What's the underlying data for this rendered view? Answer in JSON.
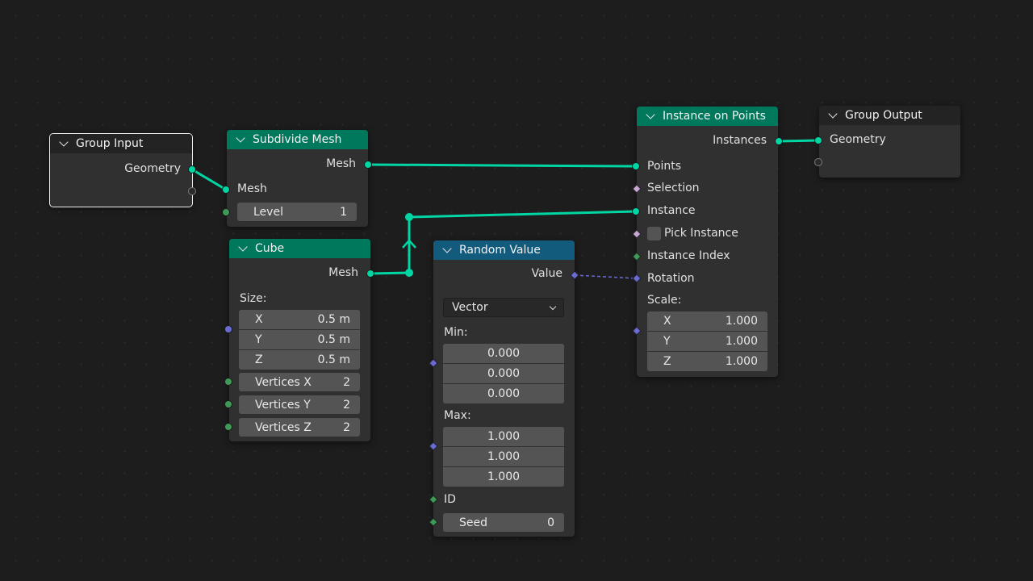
{
  "group_input": {
    "title": "Group Input",
    "geometry": "Geometry"
  },
  "subdivide_mesh": {
    "title": "Subdivide Mesh",
    "mesh_out": "Mesh",
    "mesh_in": "Mesh",
    "level_label": "Level",
    "level_value": "1"
  },
  "cube": {
    "title": "Cube",
    "mesh_out": "Mesh",
    "size_label": "Size:",
    "size": [
      {
        "axis": "X",
        "value": "0.5 m"
      },
      {
        "axis": "Y",
        "value": "0.5 m"
      },
      {
        "axis": "Z",
        "value": "0.5 m"
      }
    ],
    "vertices": [
      {
        "label": "Vertices X",
        "value": "2"
      },
      {
        "label": "Vertices Y",
        "value": "2"
      },
      {
        "label": "Vertices Z",
        "value": "2"
      }
    ]
  },
  "random_value": {
    "title": "Random Value",
    "value_out": "Value",
    "type": "Vector",
    "min_label": "Min:",
    "min": [
      "0.000",
      "0.000",
      "0.000"
    ],
    "max_label": "Max:",
    "max": [
      "1.000",
      "1.000",
      "1.000"
    ],
    "id_label": "ID",
    "seed_label": "Seed",
    "seed_value": "0"
  },
  "instance_on_points": {
    "title": "Instance on Points",
    "instances_out": "Instances",
    "points": "Points",
    "selection": "Selection",
    "instance": "Instance",
    "pick_instance": "Pick Instance",
    "instance_index": "Instance Index",
    "rotation": "Rotation",
    "scale_label": "Scale:",
    "scale": [
      {
        "axis": "X",
        "value": "1.000"
      },
      {
        "axis": "Y",
        "value": "1.000"
      },
      {
        "axis": "Z",
        "value": "1.000"
      }
    ]
  },
  "group_output": {
    "title": "Group Output",
    "geometry": "Geometry"
  },
  "colors": {
    "geometry_socket": "#00d6a3",
    "geometry_header": "#00785c",
    "utility_header": "#125b7c",
    "vector_socket": "#6b6bd6",
    "int_socket": "#3f9a58",
    "bool_socket": "#cca6d6"
  }
}
